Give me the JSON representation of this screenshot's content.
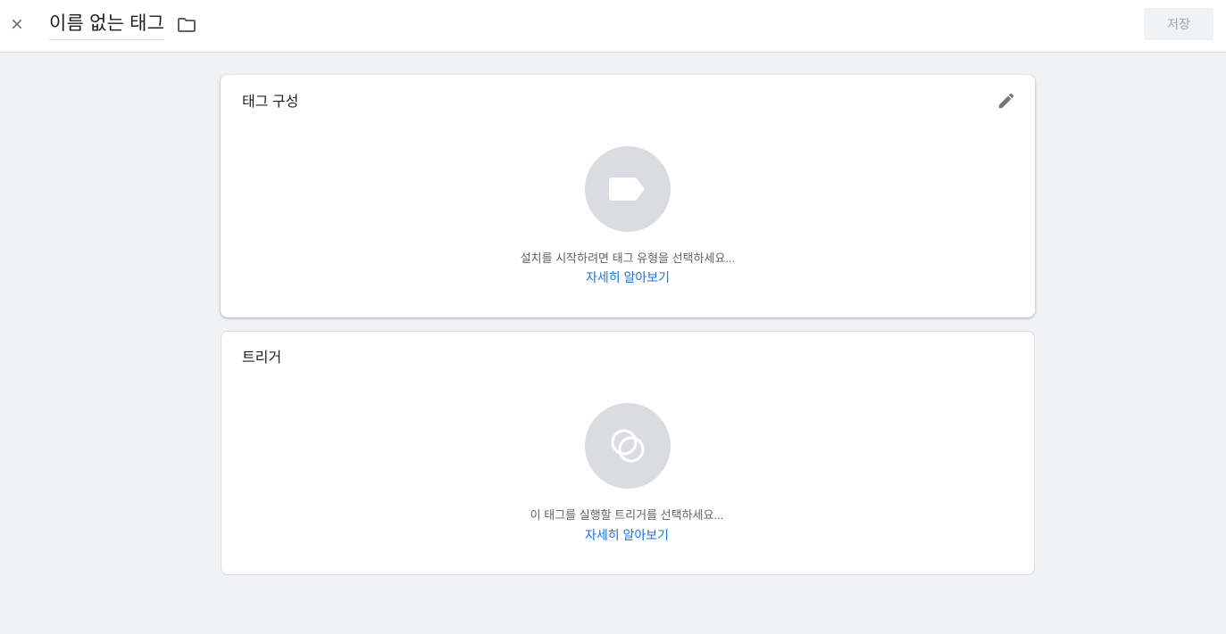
{
  "header": {
    "title": "이름 없는 태그",
    "save_label": "저장",
    "icons": {
      "close": "close-icon",
      "folder": "folder-icon"
    }
  },
  "tag_config": {
    "title": "태그 구성",
    "hint": "설치를 시작하려면 태그 유형을 선택하세요...",
    "learn_more": "자세히 알아보기",
    "icons": {
      "edit": "pencil-icon",
      "placeholder": "tag-icon"
    }
  },
  "triggers": {
    "title": "트리거",
    "hint": "이 태그를 실행할 트리거를 선택하세요...",
    "learn_more": "자세히 알아보기",
    "icons": {
      "placeholder": "trigger-icon"
    }
  },
  "colors": {
    "link": "#1a73e8",
    "placeholder_circle": "#dadce0",
    "background": "#f1f2f4"
  }
}
